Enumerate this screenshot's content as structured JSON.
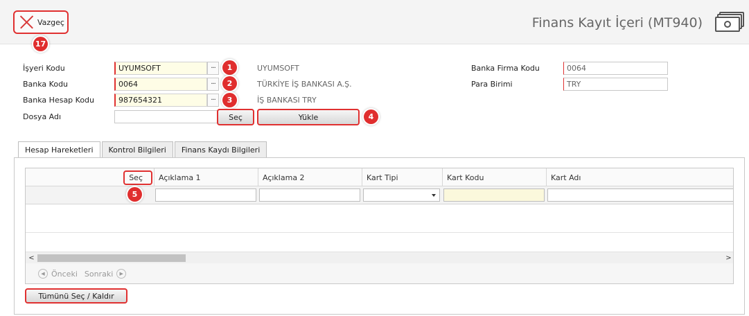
{
  "toolbar": {
    "cancel_label": "Vazgeç"
  },
  "header": {
    "title": "Finans Kayıt İçeri (MT940)",
    "icon": "money-icon"
  },
  "form": {
    "workplace_code": {
      "label": "İşyeri Kodu",
      "value": "UYUMSOFT",
      "description": "UYUMSOFT"
    },
    "bank_code": {
      "label": "Banka Kodu",
      "value": "0064",
      "description": "TÜRKİYE İŞ BANKASI A.Ş."
    },
    "bank_account_code": {
      "label": "Banka Hesap Kodu",
      "value": "987654321",
      "description": "İŞ BANKASI TRY"
    },
    "file_name": {
      "label": "Dosya Adı",
      "value": ""
    },
    "bank_company_code": {
      "label": "Banka Firma Kodu",
      "value": "0064"
    },
    "currency": {
      "label": "Para Birimi",
      "value": "TRY"
    },
    "lookup_label": "···",
    "select_button": "Seç",
    "load_button": "Yükle"
  },
  "tabs": [
    {
      "label": "Hesap Hareketleri",
      "active": true
    },
    {
      "label": "Kontrol Bilgileri",
      "active": false
    },
    {
      "label": "Finans Kaydı Bilgileri",
      "active": false
    }
  ],
  "grid": {
    "columns": [
      "Seç",
      "Açıklama 1",
      "Açıklama 2",
      "Kart Tipi",
      "Kart Kodu",
      "Kart Adı"
    ],
    "scroll_left": "<",
    "scroll_right": ">",
    "pager": {
      "prev": "Önceki",
      "next": "Sonraki",
      "prev_icon": "◀",
      "next_icon": "▶"
    }
  },
  "select_all_button": "Tümünü Seç / Kaldır",
  "badges": [
    "1",
    "2",
    "3",
    "4",
    "5",
    "17"
  ],
  "colors": {
    "accent_red": "#e03030",
    "required_field_bg": "#fefde6"
  }
}
